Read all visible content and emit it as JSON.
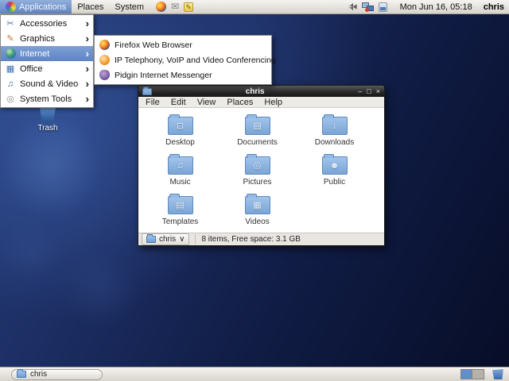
{
  "top_panel": {
    "menus": [
      {
        "label": "Applications",
        "active": true
      },
      {
        "label": "Places",
        "active": false
      },
      {
        "label": "System",
        "active": false
      }
    ],
    "launchers": [
      {
        "name": "firefox-launcher"
      },
      {
        "name": "mail-launcher"
      },
      {
        "name": "notes-launcher"
      }
    ],
    "clock": "Mon Jun 16, 05:18",
    "user": "chris"
  },
  "applications_menu": {
    "items": [
      {
        "label": "Accessories"
      },
      {
        "label": "Graphics"
      },
      {
        "label": "Internet",
        "highlighted": true
      },
      {
        "label": "Office"
      },
      {
        "label": "Sound & Video"
      },
      {
        "label": "System Tools"
      }
    ],
    "submenu": [
      {
        "label": "Firefox Web Browser"
      },
      {
        "label": "IP Telephony, VoIP and Video Conferencing"
      },
      {
        "label": "Pidgin Internet Messenger"
      }
    ]
  },
  "desktop": {
    "trash_label": "Trash"
  },
  "file_manager": {
    "title": "chris",
    "menus": [
      {
        "label": "File"
      },
      {
        "label": "Edit"
      },
      {
        "label": "View"
      },
      {
        "label": "Places"
      },
      {
        "label": "Help"
      }
    ],
    "folders": [
      {
        "name": "Desktop",
        "emblem": "⊡"
      },
      {
        "name": "Documents",
        "emblem": "▤"
      },
      {
        "name": "Downloads",
        "emblem": "↓"
      },
      {
        "name": "Music",
        "emblem": "♫"
      },
      {
        "name": "Pictures",
        "emblem": "◎"
      },
      {
        "name": "Public",
        "emblem": "☻"
      },
      {
        "name": "Templates",
        "emblem": "▤"
      },
      {
        "name": "Videos",
        "emblem": "▦"
      }
    ],
    "location_button": "chris",
    "status_text": "8 items, Free space: 3.1 GB"
  },
  "taskbar": {
    "task_button_label": "chris",
    "workspaces": {
      "count": 2,
      "active_index": 0
    }
  },
  "icons": {
    "submenu_arrow": "›",
    "minimize": "–",
    "maximize": "□",
    "close": "×",
    "dropdown": "∨",
    "mail": "✉",
    "notes": "✎",
    "accessories": "✂",
    "graphics": "✎",
    "office": "▦",
    "sound_video": "♫",
    "system_tools": "◎"
  },
  "colors": {
    "selection_blue": "#6d92cf",
    "folder_blue": "#7aa5d6",
    "desktop_dark_blue": "#101c44",
    "desktop_bright_blue": "#2b4a8f",
    "panel_gray": "#d7d3cd"
  }
}
